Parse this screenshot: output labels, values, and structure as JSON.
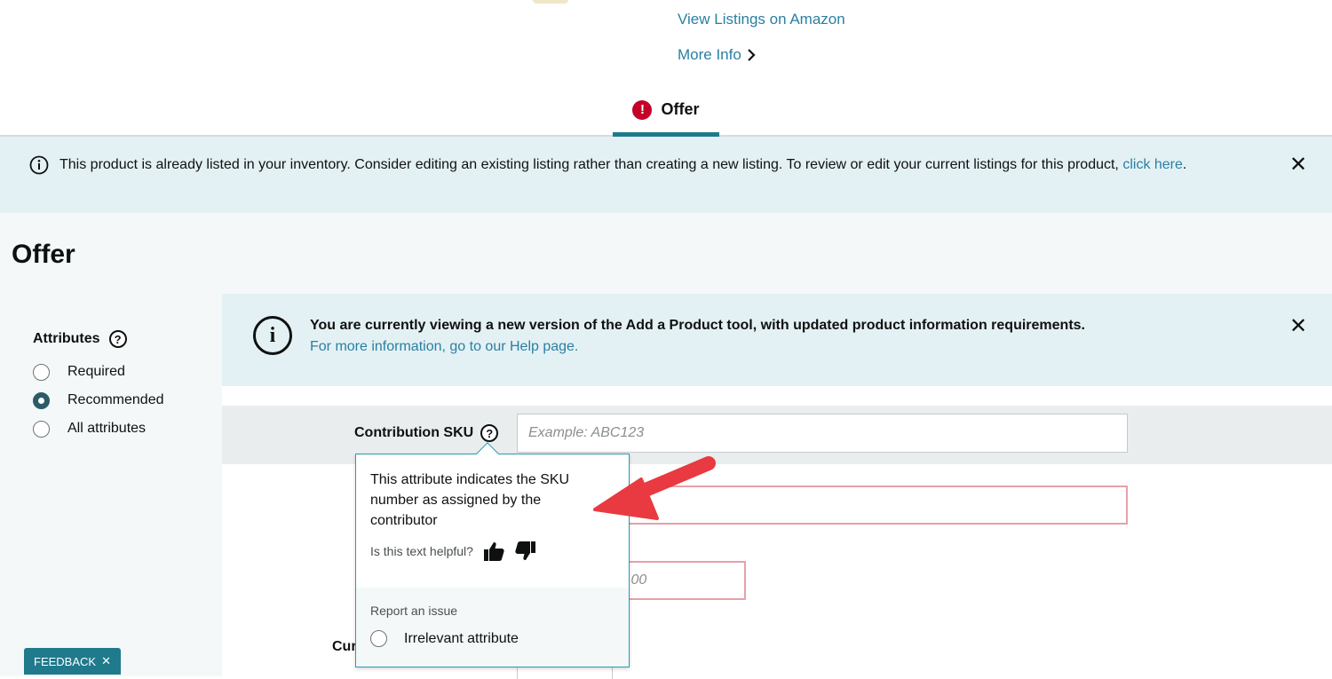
{
  "header": {
    "view_listings_link": "View Listings on Amazon",
    "more_info_link": "More Info"
  },
  "tabs": [
    {
      "label": "Offer",
      "status": "error",
      "active": true
    }
  ],
  "inventory_alert": {
    "text": "This product is already listed in your inventory. Consider editing an existing listing rather than creating a new listing. To review or edit your current listings for this product, ",
    "link": "click here",
    "suffix": "."
  },
  "page_title": "Offer",
  "attribute_filter": {
    "title": "Attributes",
    "options": [
      "Required",
      "Recommended",
      "All attributes"
    ],
    "selected": "Recommended"
  },
  "help_banner": {
    "text": "You are currently viewing a new version of the Add a Product tool, with updated product information requirements.",
    "link": "For more information, go to our Help page."
  },
  "form": {
    "contribution_sku_label": "Contribution SKU",
    "contribution_sku_placeholder": "Example: ABC123",
    "price_placeholder_fragment": ".00",
    "currency_label_fragment": "Cur"
  },
  "tooltip": {
    "text": "This attribute indicates the SKU number as assigned by the contributor",
    "helpful_prompt": "Is this text helpful?",
    "report_label": "Report an issue",
    "report_option": "Irrelevant attribute"
  },
  "feedback_button": "FEEDBACK",
  "colors": {
    "link": "#2a7fa3",
    "accent": "#1f7a8c",
    "error": "#c40028",
    "banner": "#e4f1f4",
    "arrow": "#e83a40"
  }
}
